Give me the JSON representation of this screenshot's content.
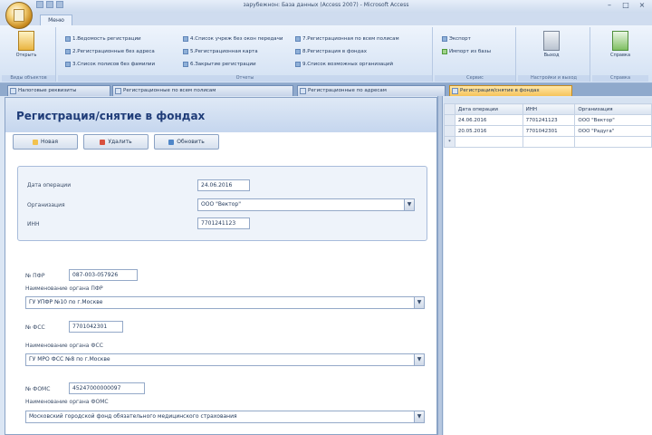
{
  "window": {
    "title": "зарубежнон: База данных (Access 2007) - Microsoft Access",
    "controls": [
      "–",
      "□",
      "×"
    ]
  },
  "ribbon": {
    "tab_label": "Меню",
    "groups": {
      "views": {
        "button": "Открыть",
        "label": "Виды объектов"
      },
      "reports": {
        "label": "Отчеты",
        "links": [
          "1.Ведомость регистрации",
          "2.Регистрационные без адреса",
          "3.Список полисов без фамилии",
          "4.Список учреж без окон передачи",
          "5.Регистрационная карта",
          "6.Закрытие регистрации",
          "7.Регистрационная по всем полисам",
          "8.Регистрация в фондах",
          "9.Список возможных организаций"
        ]
      },
      "service": {
        "label": "Сервис",
        "links": [
          "Экспорт",
          "Импорт из базы"
        ]
      },
      "settings": {
        "button": "Выход",
        "label": "Настройки и выход"
      },
      "about": {
        "button": "Справка",
        "label": "Справка"
      }
    }
  },
  "doc_tabs": [
    "Налоговые реквизиты",
    "Регистрационные по всем полисам",
    "Регистрационные по адресам",
    "Регистрация/снятие в фондах"
  ],
  "form": {
    "title": "Регистрация/снятие в фондах",
    "buttons": {
      "new": "Новая",
      "delete": "Удалить",
      "refresh": "Обновить"
    },
    "op_date_label": "Дата операции",
    "op_date_value": "24.06.2016",
    "org_label": "Организация",
    "org_value": "ООО \"Вектор\"",
    "inn_label": "ИНН",
    "inn_value": "7701241123",
    "pfr_label": "№ ПФР",
    "pfr_value": "087-003-057926",
    "pfr_org_label": "Наименование органа ПФР",
    "pfr_org_value": "ГУ УПФР №10 по г.Москве",
    "fss_label": "№ ФСС",
    "fss_value": "7701042301",
    "fss_org_label": "Наименование органа ФСС",
    "fss_org_value": "ГУ МРО ФСС №8 по г.Москве",
    "foms_label": "№ ФОМС",
    "foms_value": "45247000000097",
    "foms_org_label": "Наименование органа ФОМС",
    "foms_org_value": "Московский городской фонд обязательного медицинского страхования"
  },
  "datasheet": {
    "columns": [
      "Дата операции",
      "ИНН",
      "Организация"
    ],
    "rows": [
      [
        "24.06.2016",
        "7701241123",
        "ООО \"Вектор\""
      ],
      [
        "20.05.2016",
        "7701042301",
        "ООО \"Радуга\""
      ]
    ],
    "new_row_marker": "*"
  }
}
